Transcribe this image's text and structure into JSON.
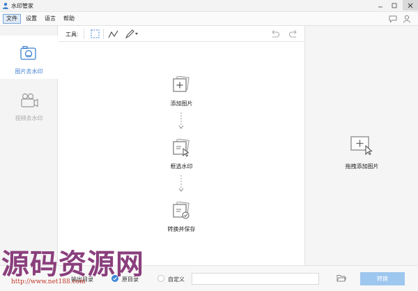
{
  "window": {
    "title": "水印管家"
  },
  "menu": {
    "items": [
      "文件",
      "设置",
      "语言",
      "帮助"
    ]
  },
  "sidebar": {
    "items": [
      {
        "label": "图片去水印",
        "active": true,
        "icon": "image-camera-icon"
      },
      {
        "label": "视频去水印",
        "active": false,
        "icon": "video-camera-icon"
      }
    ]
  },
  "toolbar": {
    "label": "工具:"
  },
  "workflow": {
    "steps": [
      {
        "label": "添加图片",
        "icon": "add-image-icon"
      },
      {
        "label": "框选水印",
        "icon": "select-watermark-icon"
      },
      {
        "label": "转换并保存",
        "icon": "convert-save-icon"
      }
    ]
  },
  "drop_area": {
    "label": "拖拽添加图片"
  },
  "bottom": {
    "output_label": "输出目录",
    "option_original": "原目录",
    "option_custom": "自定义",
    "path_value": "",
    "convert_label": "转换"
  },
  "watermark": {
    "title": "源码资源网",
    "url": "http://www.net188.com"
  },
  "colors": {
    "accent": "#3d7fd0",
    "button": "#9ec7ef",
    "watermark": "#8a3f7c"
  }
}
